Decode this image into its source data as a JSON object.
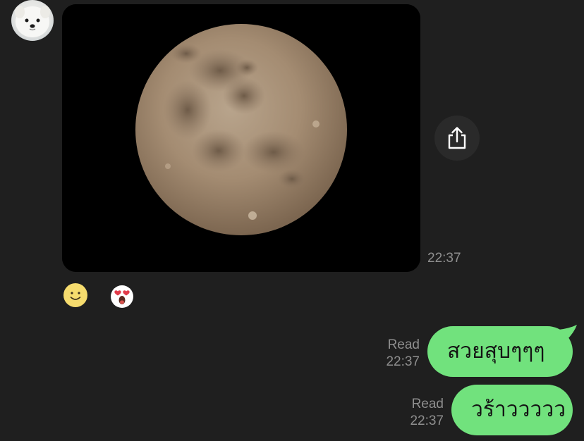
{
  "chat": {
    "incoming": {
      "avatar": "samoyed-puppy-avatar",
      "photo": "full-moon-photo",
      "time": "22:37",
      "share_icon": "share-icon"
    },
    "reactions": [
      {
        "icon": "smile-emoji-icon"
      },
      {
        "icon": "heart-eyes-emoji-icon"
      }
    ],
    "outgoing": [
      {
        "text": "สวยสุบๆๆๆ",
        "status": "Read",
        "time": "22:37"
      },
      {
        "text": "วร้าววววว",
        "status": "Read",
        "time": "22:37"
      }
    ]
  },
  "colors": {
    "background": "#1f1f1f",
    "bubble_outgoing": "#71e27d",
    "meta_text": "#8f8f8f"
  }
}
